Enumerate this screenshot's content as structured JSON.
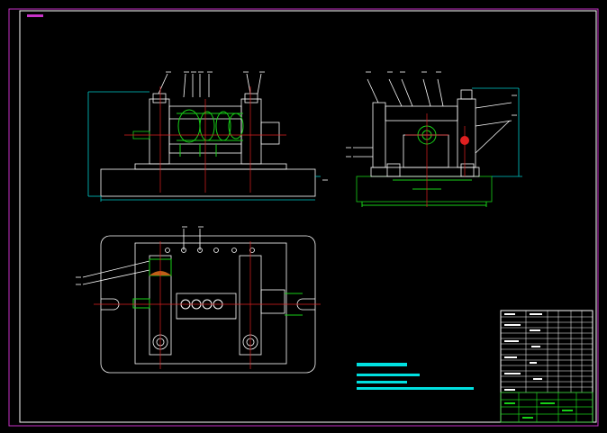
{
  "drawing": {
    "colors": {
      "background": "#000000",
      "frame": "#c832c8",
      "outline": "#ffffff",
      "centerline": "#e02020",
      "dimension": "#00c8c8",
      "part_green": "#18d018",
      "cyan_block": "#00e0e0"
    },
    "views": [
      "front-view",
      "side-view",
      "top-view"
    ]
  }
}
